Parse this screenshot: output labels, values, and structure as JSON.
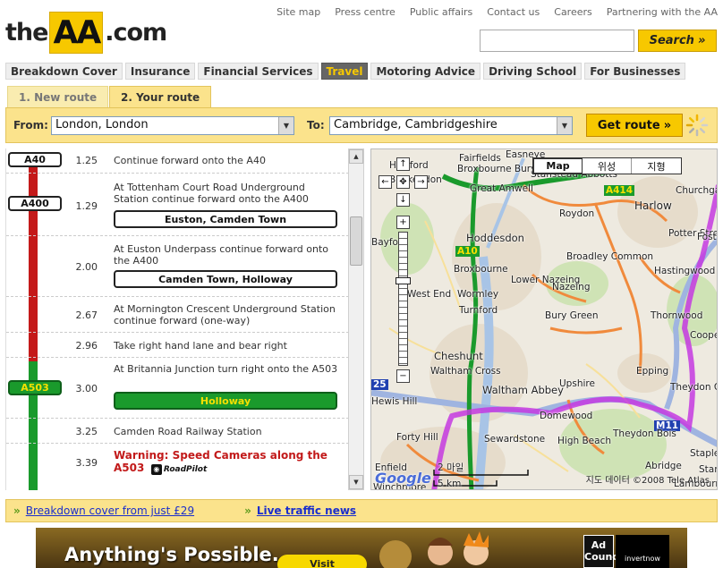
{
  "header": {
    "logo": {
      "the": "the",
      "aa": "AA",
      "com": ".com"
    },
    "toplinks": [
      "Site map",
      "Press centre",
      "Public affairs",
      "Contact us",
      "Careers",
      "Partnering with the AA"
    ],
    "search": {
      "value": "",
      "button_label": "Search"
    }
  },
  "mainnav": [
    {
      "label": "Breakdown Cover",
      "active": false
    },
    {
      "label": "Insurance",
      "active": false
    },
    {
      "label": "Financial Services",
      "active": false
    },
    {
      "label": "Travel",
      "active": true
    },
    {
      "label": "Motoring Advice",
      "active": false
    },
    {
      "label": "Driving School",
      "active": false
    },
    {
      "label": "For Businesses",
      "active": false
    }
  ],
  "route_tabs": {
    "tab1": "1. New route",
    "tab2": "2. Your route",
    "active": "2. Your route"
  },
  "route_form": {
    "from_label": "From:",
    "from_value": "London, London",
    "to_label": "To:",
    "to_value": "Cambridge, Cambridgeshire",
    "submit_label": "Get route"
  },
  "directions": {
    "steps": [
      {
        "road": "A40",
        "distance": "1.25",
        "text": "Continue forward onto the A40",
        "place": ""
      },
      {
        "road": "A400",
        "distance": "1.29",
        "text": "At Tottenham Court Road Underground Station continue forward onto the A400",
        "place": "Euston, Camden Town"
      },
      {
        "road": "",
        "distance": "2.00",
        "text": "At Euston Underpass continue forward onto the A400",
        "place": "Camden Town, Holloway"
      },
      {
        "road": "",
        "distance": "2.67",
        "text": "At Mornington Crescent Underground Station continue forward (one-way)",
        "place": ""
      },
      {
        "road": "",
        "distance": "2.96",
        "text": "Take right hand lane and bear right",
        "place": ""
      },
      {
        "road": "A503",
        "distance": "3.00",
        "text": "At Britannia Junction turn right onto the A503",
        "place": "Holloway"
      },
      {
        "road": "",
        "distance": "3.25",
        "text": "Camden Road Railway Station",
        "place": ""
      },
      {
        "road": "",
        "distance": "3.39",
        "text": "",
        "warning": "Warning: Speed Cameras along the A503",
        "brand": "RoadPilot",
        "place": ""
      }
    ]
  },
  "map": {
    "types": [
      "Map",
      "위성",
      "지형"
    ],
    "active_type": "Map",
    "labels": [
      "Hertford",
      "Easneye",
      "Stanstead Abbotts",
      "Churchgate Street",
      "Great Amwell",
      "Roydon",
      "Harlow",
      "Hoddesdon",
      "Potter Street",
      "Foster Street",
      "Broxbourne",
      "Lower Nazeing",
      "Broadley Common",
      "Hastingwood",
      "Wormley",
      "Nazeing",
      "Turnford",
      "Bury Green",
      "Thornwood",
      "Cheshunt",
      "Epping",
      "Waltham Cross",
      "Upshire",
      "Theydon Garnon",
      "Waltham Abbey",
      "Domewood",
      "Forty Hill",
      "Sewardstone",
      "High Beach",
      "Theydon Bois",
      "Abridge",
      "Stapleford Abbotts",
      "Enfield",
      "Winchmore",
      "Lambourne",
      "Stanford",
      "Hewis Hill",
      "Bayford",
      "Brickendon",
      "Fairfields",
      "Broxbourne Bury",
      "West End",
      "Coopersale"
    ],
    "roads": [
      "A10",
      "A414",
      "M11",
      "25"
    ],
    "scale": {
      "miles": "2 마일",
      "km": "5 km"
    },
    "copyright": "지도 데이터 ©2008 Tele Atlas"
  },
  "links_bar": [
    {
      "text": "Breakdown cover from just £29",
      "bold": false
    },
    {
      "text": "Live traffic news",
      "bold": true
    }
  ],
  "banner": {
    "headline": "Anything's Possible.",
    "button": "Visit",
    "ad_council": "Ad Council",
    "partner": "invertnow"
  }
}
